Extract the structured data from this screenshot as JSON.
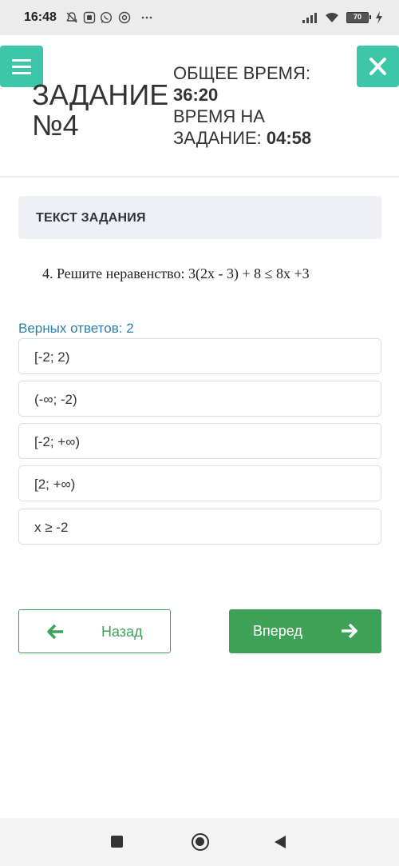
{
  "status_bar": {
    "time": "16:48",
    "battery_level": "70",
    "icons": [
      "mute-bell-icon",
      "app-icon",
      "whatsapp-icon",
      "chrome-icon",
      "more-dots-icon",
      "signal-icon",
      "wifi-icon",
      "battery-icon",
      "charging-icon"
    ]
  },
  "header": {
    "menu_icon": "hamburger-menu-icon",
    "close_icon": "close-icon",
    "task_title": "ЗАДАНИЕ №4",
    "total_time_label": "ОБЩЕЕ ВРЕМЯ:",
    "total_time_value": "36:20",
    "task_time_label_line1": "ВРЕМЯ НА",
    "task_time_label_line2": "ЗАДАНИЕ: ",
    "task_time_value": "04:58"
  },
  "task": {
    "panel_title": "ТЕКСТ ЗАДАНИЯ",
    "question": "4. Решите неравенство: 3(2x - 3) + 8 ≤ 8x +3",
    "correct_answers": "Верных ответов: 2"
  },
  "options": [
    {
      "label": "[-2; 2)"
    },
    {
      "label": "(-∞; -2)"
    },
    {
      "label": "[-2; +∞)"
    },
    {
      "label": "[2; +∞)"
    },
    {
      "label": "x ≥ -2"
    }
  ],
  "navigation": {
    "back_label": "Назад",
    "next_label": "Вперед",
    "back_icon": "arrow-left-icon",
    "next_icon": "arrow-right-icon"
  },
  "colors": {
    "teal": "#3ec6a8",
    "green": "#3ea158",
    "info_blue": "#2b7fa8",
    "panel_bg": "#eef0f5"
  }
}
